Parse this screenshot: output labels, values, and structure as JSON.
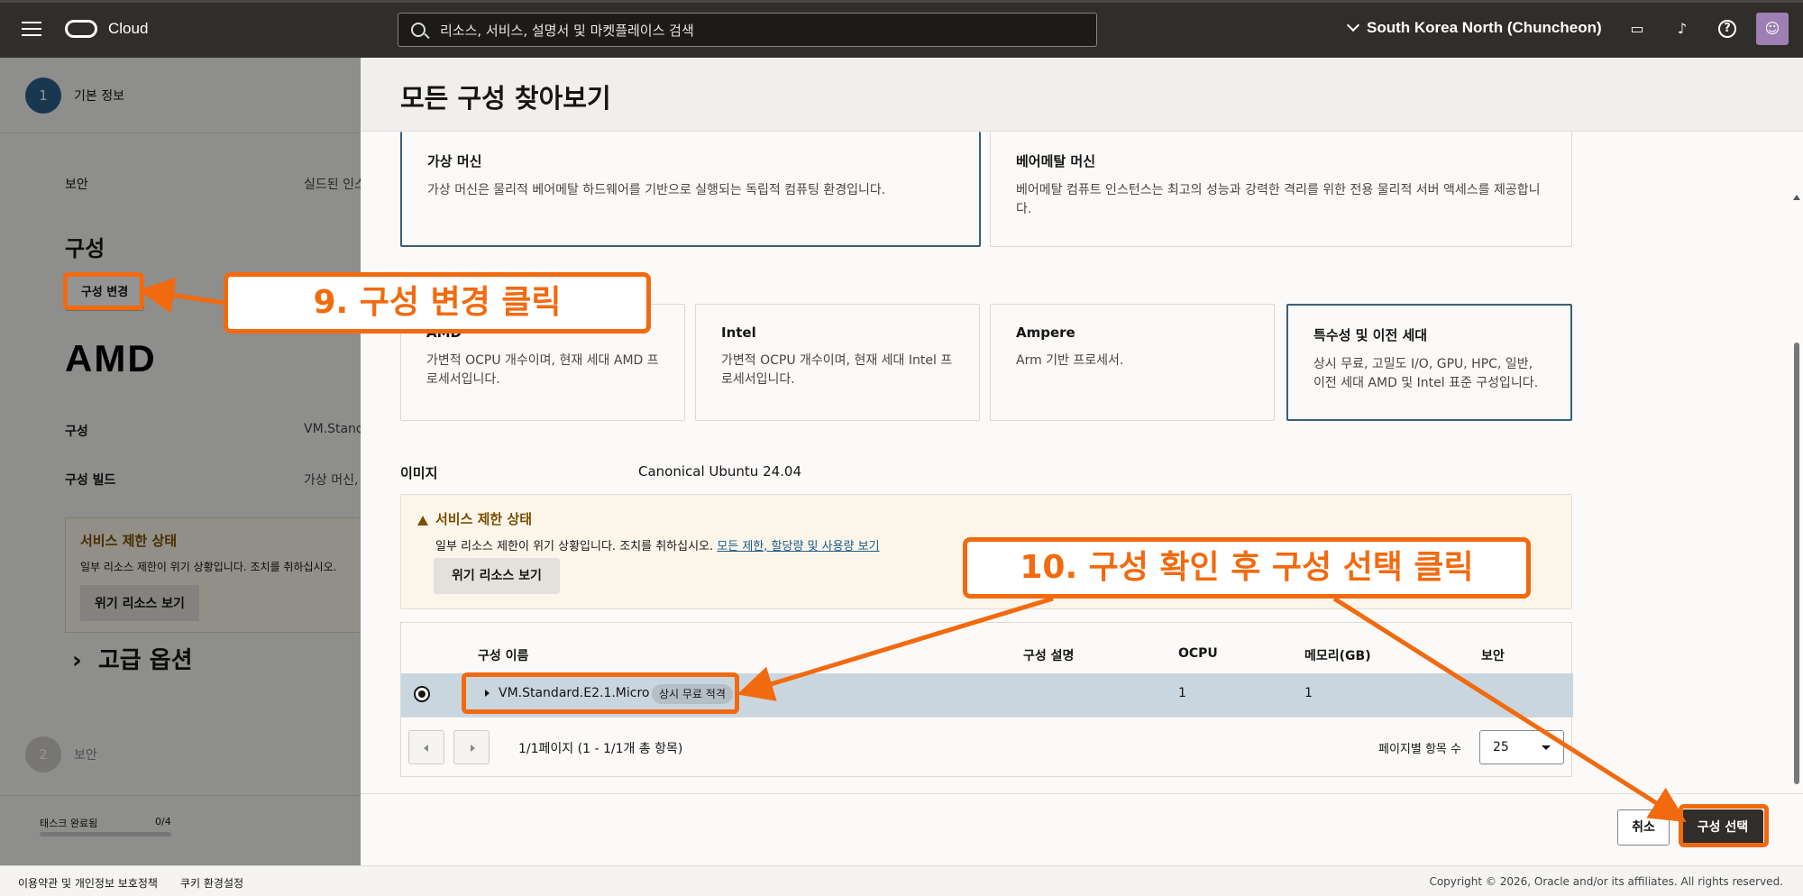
{
  "topnav": {
    "brand": "Cloud",
    "search_placeholder": "리소스, 서비스, 설명서 및 마켓플레이스 검색",
    "region": "South Korea North (Chuncheon)"
  },
  "background": {
    "step1_num": "1",
    "step1_label": "기본 정보",
    "security_label": "보안",
    "security_value": "실드된 인스",
    "config_heading": "구성",
    "change_config_button": "구성 변경",
    "amd_logo": "AMD",
    "shape_label": "구성",
    "shape_value": "VM.Stand",
    "shape_build_label": "구성 빌드",
    "shape_build_value": "가상 머신,",
    "warn_title": "서비스 제한 상태",
    "warn_desc": "일부 리소스 제한이 위기 상황입니다. 조치를 취하십시오.",
    "warn_button": "위기 리소스 보기",
    "advanced": "고급 옵션",
    "step2_num": "2",
    "step2_label": "보안",
    "task_label": "태스크 완료됨",
    "task_count": "0/4"
  },
  "panel": {
    "title": "모든 구성 찾아보기",
    "instance_types": [
      {
        "title": "가상 머신",
        "desc": "가상 머신은 물리적 베어메탈 하드웨어를 기반으로 실행되는 독립적 컴퓨팅 환경입니다.",
        "selected": true
      },
      {
        "title": "베어메탈 머신",
        "desc": "베어메탈 컴퓨트 인스턴스는 최고의 성능과 강력한 격리를 위한 전용 물리적 서버 액세스를 제공합니다.",
        "selected": false
      }
    ],
    "series": [
      {
        "title": "AMD",
        "desc": "가변적 OCPU 개수이며, 현재 세대 AMD 프로세서입니다.",
        "selected": false
      },
      {
        "title": "Intel",
        "desc": "가변적 OCPU 개수이며, 현재 세대 Intel 프로세서입니다.",
        "selected": false
      },
      {
        "title": "Ampere",
        "desc": "Arm 기반 프로세서.",
        "selected": false
      },
      {
        "title": "특수성 및 이전 세대",
        "desc": "상시 무료, 고밀도 I/O, GPU, HPC, 일반, 이전 세대 AMD 및 Intel 표준 구성입니다.",
        "selected": true
      }
    ],
    "image_label": "이미지",
    "image_value": "Canonical Ubuntu 24.04",
    "warning": {
      "title": "서비스 제한 상태",
      "desc": "일부 리소스 제한이 위기 상황입니다. 조치를 취하십시오.",
      "link": "모든 제한, 할당량 및 사용량 보기",
      "button": "위기 리소스 보기"
    },
    "table": {
      "columns": [
        "구성 이름",
        "구성 설명",
        "OCPU",
        "메모리(GB)",
        "보안"
      ],
      "row": {
        "name": "VM.Standard.E2.1.Micro",
        "badge": "상시 무료 적격",
        "desc": "",
        "ocpu": "1",
        "memory": "1",
        "security": ""
      },
      "pager_info": "1/1페이지 (1 - 1/1개 총 항목)",
      "per_page_label": "페이지별 항목 수",
      "per_page_value": "25"
    },
    "cancel": "취소",
    "select": "구성 선택"
  },
  "annotations": {
    "step9": "9. 구성 변경 클릭",
    "step10": "10. 구성 확인 후 구성 선택 클릭"
  },
  "footer": {
    "terms": "이용약관 및 개인정보 보호정책",
    "cookies": "쿠키 환경설정",
    "copyright": "Copyright © 2026, Oracle and/or its affiliates. All rights reserved."
  },
  "colors": {
    "annotation": "#f26a0f",
    "nav": "#312d2a",
    "selected_row": "#c9d6e0"
  }
}
